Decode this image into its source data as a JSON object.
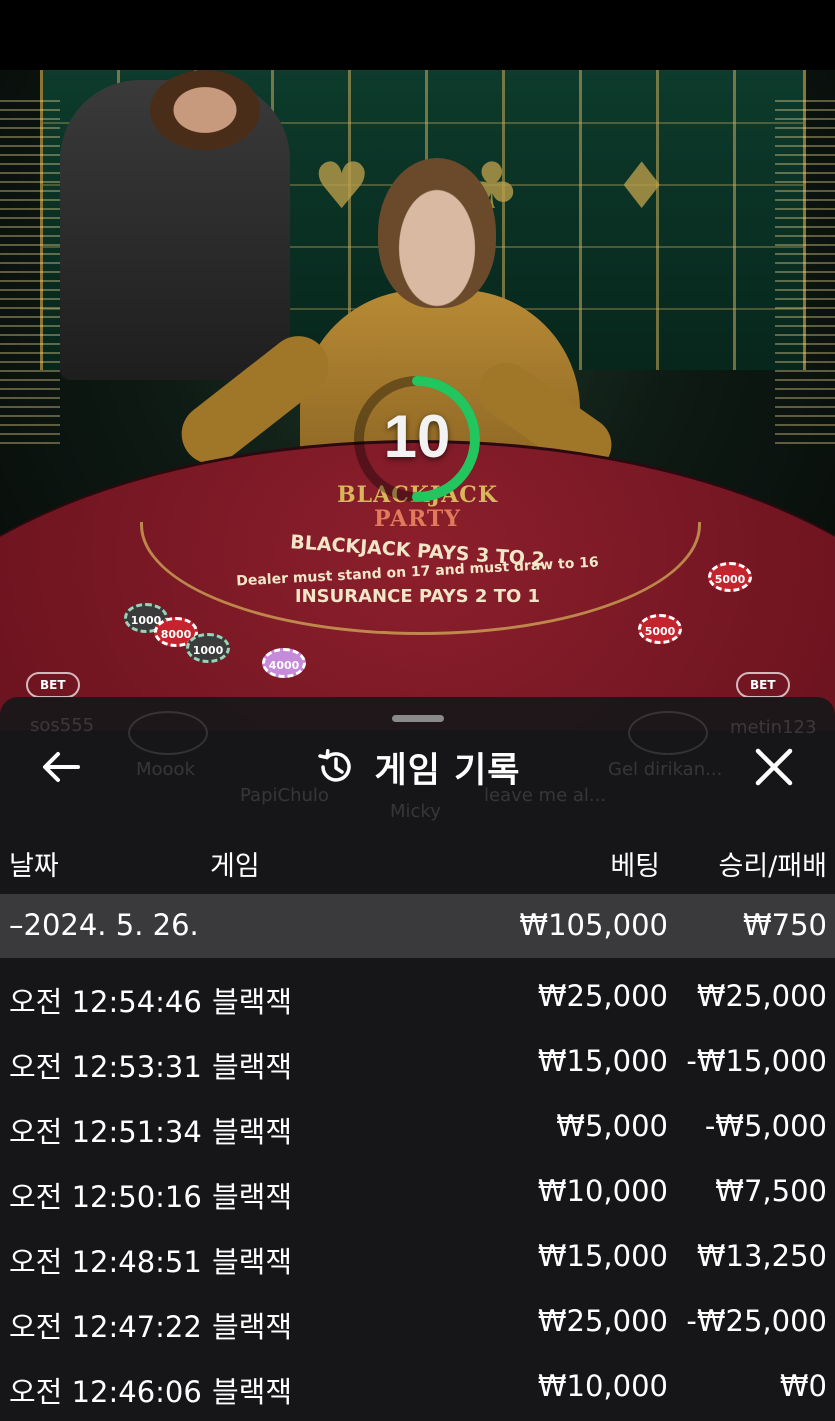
{
  "scene": {
    "countdown": "10",
    "table": {
      "logo_line1": "BLACKJACK",
      "logo_line2": "PARTY",
      "line1": "BLACKJACK PAYS 3 TO 2",
      "line2": "Dealer must stand on 17 and must draw to 16",
      "line3": "INSURANCE PAYS 2 TO 1"
    },
    "chips": [
      "1000",
      "8000",
      "1000",
      "4000",
      "5000",
      "5000"
    ],
    "bet_behind_label": "BET",
    "seats": [
      "sos555",
      "Moook",
      "PapiChulo",
      "Micky",
      "leave me al...",
      "Gel dirikan...",
      "metin123"
    ]
  },
  "history": {
    "title": "게임 기록",
    "columns": {
      "date": "날짜",
      "game": "게임",
      "bet": "베팅",
      "result": "승리/패배"
    },
    "summary": {
      "date": "–2024. 5. 26.",
      "bet": "₩105,000",
      "result": "₩750"
    },
    "rows": [
      {
        "time": "오전 12:54:46",
        "game": "블랙잭",
        "bet": "₩25,000",
        "result": "₩25,000"
      },
      {
        "time": "오전 12:53:31",
        "game": "블랙잭",
        "bet": "₩15,000",
        "result": "-₩15,000"
      },
      {
        "time": "오전 12:51:34",
        "game": "블랙잭",
        "bet": "₩5,000",
        "result": "-₩5,000"
      },
      {
        "time": "오전 12:50:16",
        "game": "블랙잭",
        "bet": "₩10,000",
        "result": "₩7,500"
      },
      {
        "time": "오전 12:48:51",
        "game": "블랙잭",
        "bet": "₩15,000",
        "result": "₩13,250"
      },
      {
        "time": "오전 12:47:22",
        "game": "블랙잭",
        "bet": "₩25,000",
        "result": "-₩25,000"
      },
      {
        "time": "오전 12:46:06",
        "game": "블랙잭",
        "bet": "₩10,000",
        "result": "₩0"
      }
    ]
  },
  "colors": {
    "sheet_bg": "#18181a",
    "summary_bg": "#3a3a3d",
    "timer_ring": "#22c55e",
    "felt": "#8c1f2c"
  },
  "icons": {
    "back": "arrow-left-icon",
    "history": "history-clock-icon",
    "close": "close-icon"
  }
}
